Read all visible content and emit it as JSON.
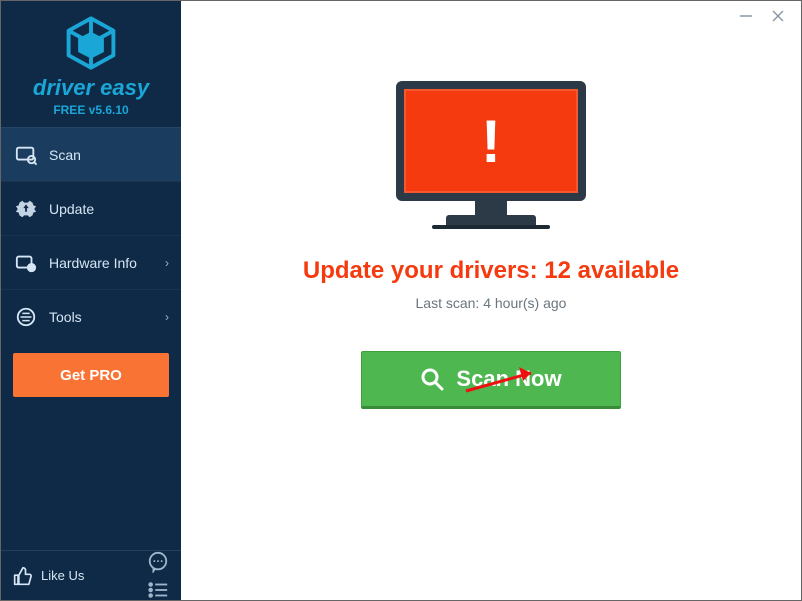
{
  "app": {
    "name": "driver easy",
    "version_label": "FREE v5.6.10"
  },
  "sidebar": {
    "items": [
      {
        "label": "Scan"
      },
      {
        "label": "Update"
      },
      {
        "label": "Hardware Info"
      },
      {
        "label": "Tools"
      }
    ],
    "get_pro_label": "Get PRO",
    "like_us_label": "Like Us"
  },
  "main": {
    "headline": "Update your drivers: 12 available",
    "last_scan": "Last scan: 4 hour(s) ago",
    "scan_button_label": "Scan Now"
  }
}
